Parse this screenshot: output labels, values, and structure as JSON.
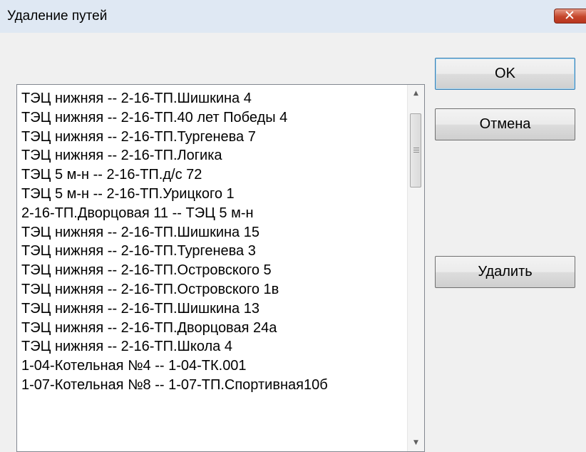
{
  "dialog": {
    "title": "Удаление путей"
  },
  "list": {
    "items": [
      "ТЭЦ нижняя -- 2-16-ТП.Шишкина 4",
      "ТЭЦ нижняя -- 2-16-ТП.40 лет Победы 4",
      "ТЭЦ нижняя -- 2-16-ТП.Тургенева 7",
      "ТЭЦ нижняя -- 2-16-ТП.Логика",
      "ТЭЦ 5 м-н -- 2-16-ТП.д/с 72",
      "ТЭЦ 5 м-н -- 2-16-ТП.Урицкого 1",
      "2-16-ТП.Дворцовая 11 -- ТЭЦ 5 м-н",
      "ТЭЦ нижняя -- 2-16-ТП.Шишкина 15",
      "ТЭЦ нижняя -- 2-16-ТП.Тургенева 3",
      "ТЭЦ нижняя -- 2-16-ТП.Островского 5",
      "ТЭЦ нижняя -- 2-16-ТП.Островского 1в",
      "ТЭЦ нижняя -- 2-16-ТП.Шишкина 13",
      "ТЭЦ нижняя -- 2-16-ТП.Дворцовая 24а",
      "ТЭЦ нижняя -- 2-16-ТП.Школа 4",
      "1-04-Котельная №4 -- 1-04-ТК.001",
      "1-07-Котельная №8 -- 1-07-ТП.Спортивная10б"
    ]
  },
  "buttons": {
    "ok": "OK",
    "cancel": "Отмена",
    "delete": "Удалить"
  },
  "icons": {
    "close": "close-icon",
    "scroll_up": "scroll-up-arrow-icon",
    "scroll_down": "scroll-down-arrow-icon"
  }
}
